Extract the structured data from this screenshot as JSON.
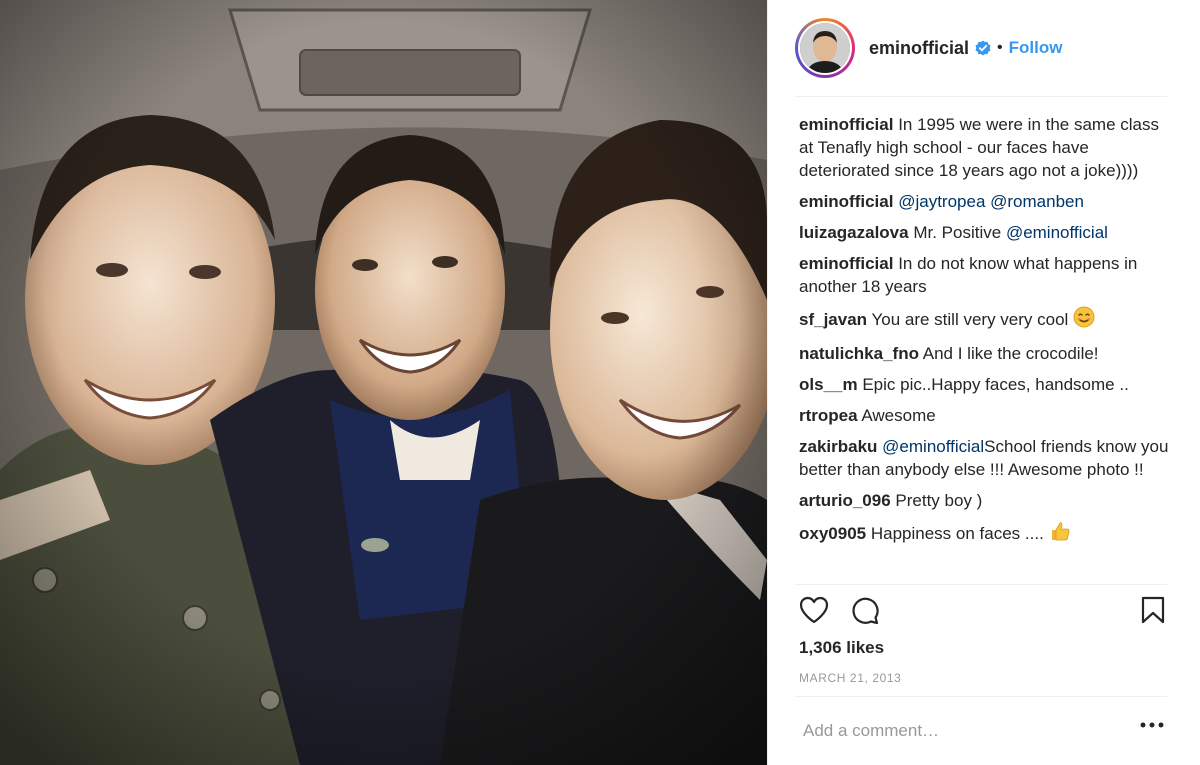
{
  "post": {
    "photo_alt": "",
    "header": {
      "username": "eminofficial",
      "separator": "•",
      "follow_label": "Follow"
    },
    "comments": [
      {
        "user": "eminofficial",
        "parts": [
          {
            "text": "In 1995 we were in the same class at Tenafly high school - our faces have deteriorated since 18 years ago not a joke))))"
          }
        ]
      },
      {
        "user": "eminofficial",
        "parts": [
          {
            "mention": "@jaytropea"
          },
          {
            "text": " "
          },
          {
            "mention": "@romanben"
          }
        ]
      },
      {
        "user": "luizagazalova",
        "parts": [
          {
            "text": "Mr. Positive "
          },
          {
            "mention": "@eminofficial"
          }
        ]
      },
      {
        "user": "eminofficial",
        "parts": [
          {
            "text": "In do not know what happens in another 18 years"
          }
        ]
      },
      {
        "user": "sf_javan",
        "parts": [
          {
            "text": "You are still very very cool "
          }
        ],
        "emoji": "smile"
      },
      {
        "user": "natulichka_fno",
        "parts": [
          {
            "text": "And I like the crocodile!"
          }
        ]
      },
      {
        "user": "ols__m",
        "parts": [
          {
            "text": "Epic pic..Happy faces, handsome .."
          }
        ]
      },
      {
        "user": "rtropea",
        "parts": [
          {
            "text": "Awesome"
          }
        ]
      },
      {
        "user": "zakirbaku",
        "parts": [
          {
            "mention": "@eminofficial"
          },
          {
            "text": "School friends know you better than anybody else !!! Awesome photo !!"
          }
        ]
      },
      {
        "user": "arturio_096",
        "parts": [
          {
            "text": "Pretty boy )"
          }
        ]
      },
      {
        "user": "oxy0905",
        "parts": [
          {
            "text": "Happiness on faces .... "
          }
        ],
        "emoji": "thumbs-up"
      }
    ],
    "likes": "1,306 likes",
    "date": "MARCH 21, 2013",
    "add_comment_placeholder": "Add a comment…",
    "more_label": "•••",
    "colors": {
      "link": "#3897f0",
      "mention": "#003569",
      "muted": "#999999",
      "divider": "#efefef"
    }
  }
}
